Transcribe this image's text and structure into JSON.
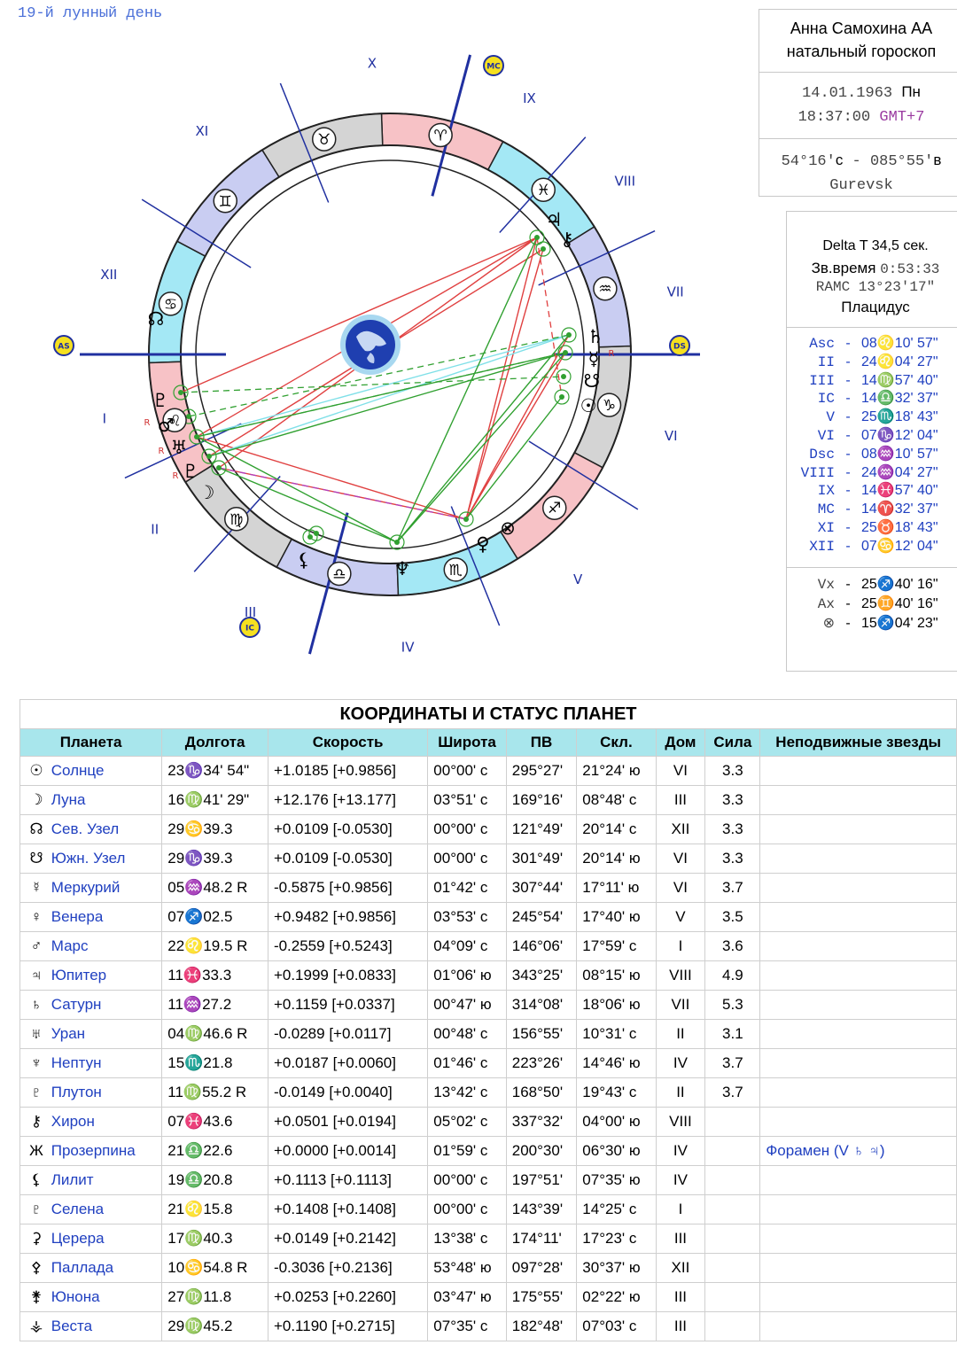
{
  "lunar_day": "19-й лунный день",
  "chart": {
    "houses_roman": [
      "I",
      "II",
      "III",
      "IV",
      "V",
      "VI",
      "VII",
      "VIII",
      "IX",
      "X",
      "XI",
      "XII"
    ],
    "angle_badges": {
      "asc": "AS",
      "mc": "MC",
      "dsc": "DS",
      "ic": "IC"
    },
    "zodiac_signs": [
      "♉",
      "♈",
      "♓",
      "♒",
      "♑",
      "♐",
      "♏",
      "♎",
      "♍",
      "♌",
      "♋",
      "♊"
    ],
    "planet_glyphs": [
      "♃",
      "⚷",
      "♄",
      "☿",
      "☋",
      "☉",
      "♇",
      "♂",
      "♅",
      "♇",
      "☽",
      "⚸",
      "♆",
      "♀",
      "⊗",
      "☊"
    ],
    "retro_marker": "R"
  },
  "header_panel": {
    "name": "Анна  Самохина  АА",
    "subtitle": "натальный  гороскоп",
    "date": "14.01.1963",
    "weekday": "Пн",
    "time": "18:37:00",
    "gmt": "GMT+7",
    "lat": "54°16'",
    "lat_dir": "с",
    "sep": "-",
    "lon": "085°55'",
    "lon_dir": "в",
    "place": "Gurevsk"
  },
  "houses_panel": {
    "delta_t": "Delta T   34,5 сек.",
    "sidereal_label": "Зв.время",
    "sidereal_value": "0:53:33",
    "ramc": "RAMC 13°23'17\"",
    "system": "Плацидус",
    "cusps": [
      {
        "name": "Asc",
        "value": "08♌10' 57\""
      },
      {
        "name": "II",
        "value": "24♌04' 27\""
      },
      {
        "name": "III",
        "value": "14♍57' 40\""
      },
      {
        "name": "IC",
        "value": "14♎32' 37\""
      },
      {
        "name": "V",
        "value": "25♏18' 43\""
      },
      {
        "name": "VI",
        "value": "07♑12' 04\""
      },
      {
        "name": "Dsc",
        "value": "08♒10' 57\""
      },
      {
        "name": "VIII",
        "value": "24♒04' 27\""
      },
      {
        "name": "IX",
        "value": "14♓57' 40\""
      },
      {
        "name": "MC",
        "value": "14♈32' 37\""
      },
      {
        "name": "XI",
        "value": "25♉18' 43\""
      },
      {
        "name": "XII",
        "value": "07♋12' 04\""
      }
    ],
    "points": [
      {
        "name": "Vx",
        "value": "25♐40' 16\""
      },
      {
        "name": "Ax",
        "value": "25♊40' 16\""
      },
      {
        "name": "⊗",
        "value": "15♐04' 23\""
      }
    ]
  },
  "table": {
    "title": "КООРДИНАТЫ  И  СТАТУС  ПЛАНЕТ",
    "headers": [
      "Планета",
      "Долгота",
      "Скорость",
      "Широта",
      "ПВ",
      "Скл.",
      "Дом",
      "Сила",
      "Неподвижные звезды"
    ],
    "rows": [
      {
        "glyph": "☉",
        "name": "Солнце",
        "lon": "23♑34' 54\"",
        "speed": "+1.0185  [+0.9856]",
        "lat": "00°00' с",
        "ra": "295°27'",
        "decl": "21°24' ю",
        "house": "VI",
        "power": "3.3",
        "stars": ""
      },
      {
        "glyph": "☽",
        "name": "Луна",
        "lon": "16♍41' 29\"",
        "speed": "+12.176  [+13.177]",
        "lat": "03°51' с",
        "ra": "169°16'",
        "decl": "08°48' с",
        "house": "III",
        "power": "3.3",
        "stars": ""
      },
      {
        "glyph": "☊",
        "name": "Сев. Узел",
        "lon": "29♋39.3",
        "speed": "+0.0109  [-0.0530]",
        "lat": "00°00' с",
        "ra": "121°49'",
        "decl": "20°14' с",
        "house": "XII",
        "power": "3.3",
        "stars": ""
      },
      {
        "glyph": "☋",
        "name": "Южн. Узел",
        "lon": "29♑39.3",
        "speed": "+0.0109  [-0.0530]",
        "lat": "00°00' с",
        "ra": "301°49'",
        "decl": "20°14' ю",
        "house": "VI",
        "power": "3.3",
        "stars": ""
      },
      {
        "glyph": "☿",
        "name": "Меркурий",
        "lon": "05♒48.2  R",
        "speed": "-0.5875  [+0.9856]",
        "lat": "01°42' с",
        "ra": "307°44'",
        "decl": "17°11' ю",
        "house": "VI",
        "power": "3.7",
        "stars": ""
      },
      {
        "glyph": "♀",
        "name": "Венера",
        "lon": "07♐02.5",
        "speed": "+0.9482  [+0.9856]",
        "lat": "03°53' с",
        "ra": "245°54'",
        "decl": "17°40' ю",
        "house": "V",
        "power": "3.5",
        "stars": ""
      },
      {
        "glyph": "♂",
        "name": "Марс",
        "lon": "22♌19.5  R",
        "speed": "-0.2559  [+0.5243]",
        "lat": "04°09' с",
        "ra": "146°06'",
        "decl": "17°59' с",
        "house": "I",
        "power": "3.6",
        "stars": ""
      },
      {
        "glyph": "♃",
        "name": "Юпитер",
        "lon": "11♓33.3",
        "speed": "+0.1999  [+0.0833]",
        "lat": "01°06' ю",
        "ra": "343°25'",
        "decl": "08°15' ю",
        "house": "VIII",
        "power": "4.9",
        "stars": ""
      },
      {
        "glyph": "♄",
        "name": "Сатурн",
        "lon": "11♒27.2",
        "speed": "+0.1159  [+0.0337]",
        "lat": "00°47' ю",
        "ra": "314°08'",
        "decl": "18°06' ю",
        "house": "VII",
        "power": "5.3",
        "stars": ""
      },
      {
        "glyph": "♅",
        "name": "Уран",
        "lon": "04♍46.6  R",
        "speed": "-0.0289  [+0.0117]",
        "lat": "00°48' с",
        "ra": "156°55'",
        "decl": "10°31' с",
        "house": "II",
        "power": "3.1",
        "stars": ""
      },
      {
        "glyph": "♆",
        "name": "Нептун",
        "lon": "15♏21.8",
        "speed": "+0.0187  [+0.0060]",
        "lat": "01°46' с",
        "ra": "223°26'",
        "decl": "14°46' ю",
        "house": "IV",
        "power": "3.7",
        "stars": ""
      },
      {
        "glyph": "♇",
        "name": "Плутон",
        "lon": "11♍55.2  R",
        "speed": "-0.0149  [+0.0040]",
        "lat": "13°42' с",
        "ra": "168°50'",
        "decl": "19°43' с",
        "house": "II",
        "power": "3.7",
        "stars": ""
      },
      {
        "glyph": "⚷",
        "name": "Хирон",
        "lon": "07♓43.6",
        "speed": "+0.0501  [+0.0194]",
        "lat": "05°02' с",
        "ra": "337°32'",
        "decl": "04°00' ю",
        "house": "VIII",
        "power": "",
        "stars": ""
      },
      {
        "glyph": "Ж",
        "name": "Прозерпина",
        "lon": "21♎22.6",
        "speed": "+0.0000  [+0.0014]",
        "lat": "01°59' с",
        "ra": "200°30'",
        "decl": "06°30' ю",
        "house": "IV",
        "power": "",
        "stars": "Форамен (V ♄ ♃)"
      },
      {
        "glyph": "⚸",
        "name": "Лилит",
        "lon": "19♎20.8",
        "speed": "+0.1113  [+0.1113]",
        "lat": "00°00' с",
        "ra": "197°51'",
        "decl": "07°35' ю",
        "house": "IV",
        "power": "",
        "stars": ""
      },
      {
        "glyph": "♇",
        "name": "Селена",
        "lon": "21♌15.8",
        "speed": "+0.1408  [+0.1408]",
        "lat": "00°00' с",
        "ra": "143°39'",
        "decl": "14°25' с",
        "house": "I",
        "power": "",
        "stars": ""
      },
      {
        "glyph": "⚳",
        "name": "Церера",
        "lon": "17♍40.3",
        "speed": "+0.0149  [+0.2142]",
        "lat": "13°38' с",
        "ra": "174°11'",
        "decl": "17°23' с",
        "house": "III",
        "power": "",
        "stars": ""
      },
      {
        "glyph": "⚴",
        "name": "Паллада",
        "lon": "10♋54.8  R",
        "speed": "-0.3036  [+0.2136]",
        "lat": "53°48' ю",
        "ra": "097°28'",
        "decl": "30°37' ю",
        "house": "XII",
        "power": "",
        "stars": ""
      },
      {
        "glyph": "⚵",
        "name": "Юнона",
        "lon": "27♍11.8",
        "speed": "+0.0253  [+0.2260]",
        "lat": "03°47' ю",
        "ra": "175°55'",
        "decl": "02°22' ю",
        "house": "III",
        "power": "",
        "stars": ""
      },
      {
        "glyph": "⚶",
        "name": "Веста",
        "lon": "29♍45.2",
        "speed": "+0.1190  [+0.2715]",
        "lat": "07°35' с",
        "ra": "182°48'",
        "decl": "07°03' с",
        "house": "III",
        "power": "",
        "stars": ""
      }
    ]
  }
}
